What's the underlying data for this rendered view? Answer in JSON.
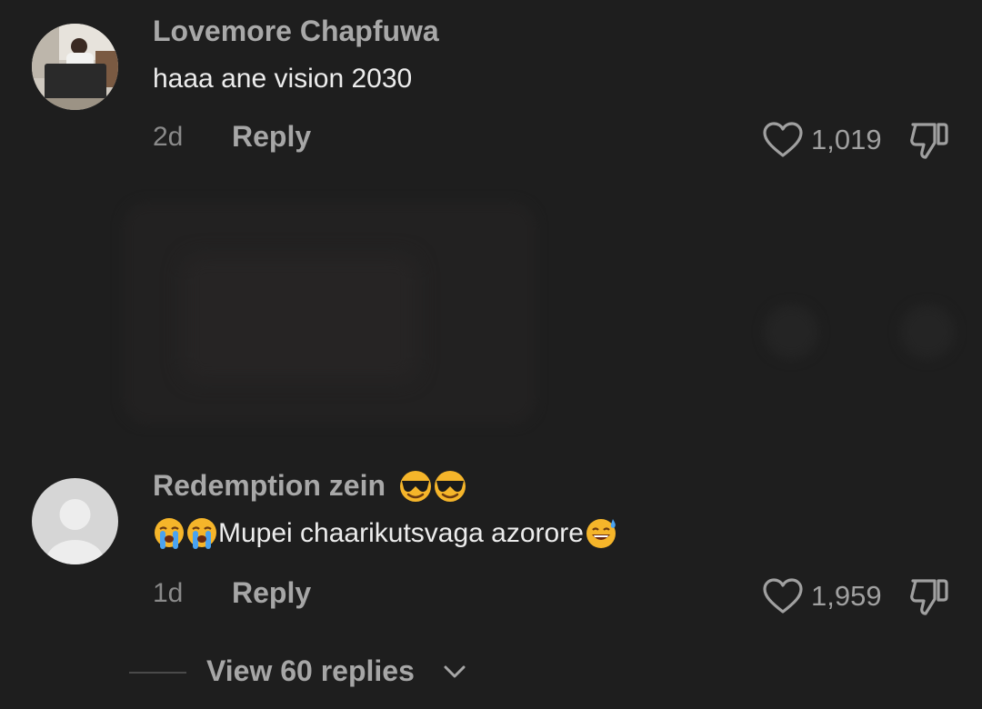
{
  "comments": [
    {
      "username": "Lovemore Chapfuwa",
      "text": "haaa ane vision 2030",
      "time": "2d",
      "reply_label": "Reply",
      "likes": "1,019",
      "avatar": "user-photo-laptop-icon"
    },
    {
      "username": "Redemption zein",
      "username_emoji": "smiling-face-with-sunglasses-icon",
      "text": "Mupei chaarikutsvaga azorore",
      "text_leading_emoji": "loudly-crying-face-icon",
      "text_trailing_emoji": "grinning-face-with-sweat-icon",
      "time": "1d",
      "reply_label": "Reply",
      "likes": "1,959",
      "avatar": "default-avatar-icon"
    }
  ],
  "view_replies": {
    "label": "View 60 replies"
  },
  "colors": {
    "background": "#1e1e1e",
    "username": "#a8a8a8",
    "text": "#ececec",
    "meta": "#8a8a8a"
  }
}
